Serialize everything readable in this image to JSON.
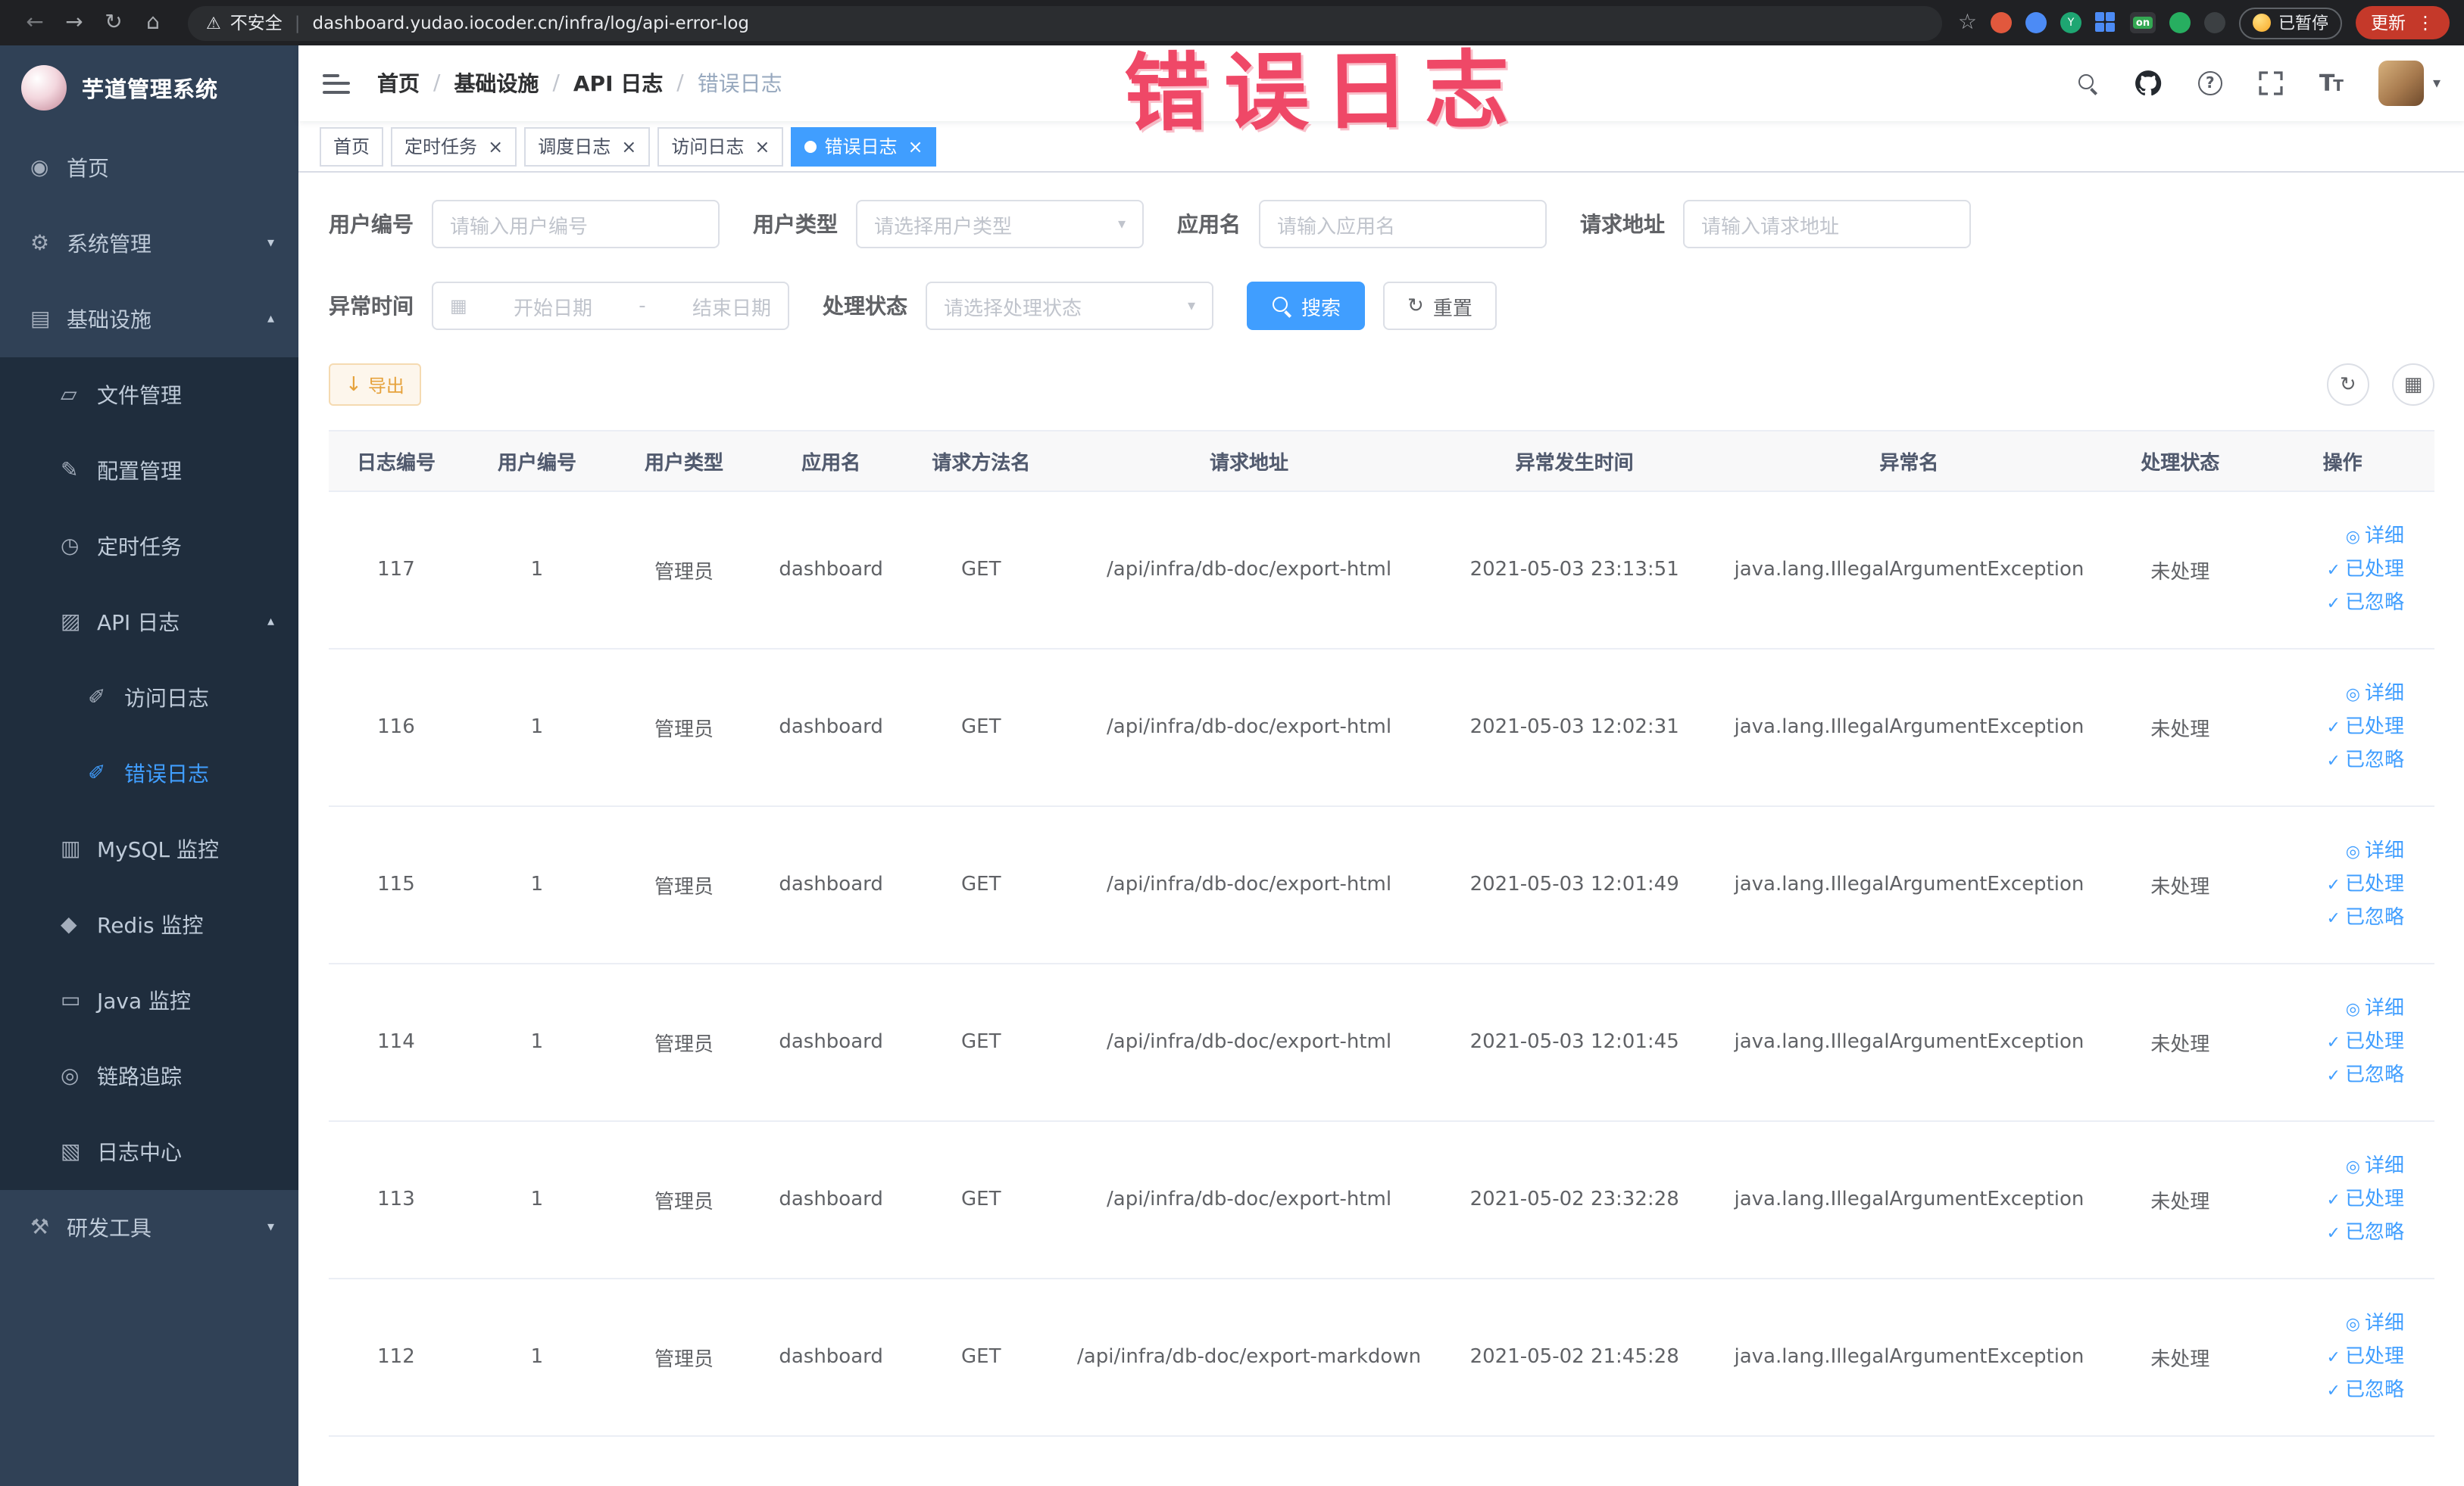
{
  "colors": {
    "accent": "#409eff",
    "sidebar_bg": "#304156",
    "submenu_bg": "#1f2d3d",
    "warning": "#e6a23c",
    "annotation": "#ee3b5c"
  },
  "annotation": {
    "text": "错误日志"
  },
  "browser": {
    "security_label": "不安全",
    "url": "dashboard.yudao.iocoder.cn/infra/log/api-error-log",
    "on_badge": "on",
    "paused_label": "已暂停",
    "update_label": "更新"
  },
  "sidebar": {
    "logo_title": "芋道管理系统",
    "items": [
      {
        "id": "home",
        "label": "首页",
        "icon": "dashboard-icon",
        "level": 0
      },
      {
        "id": "system",
        "label": "系统管理",
        "icon": "gear-icon",
        "level": 0,
        "arrow": "down"
      },
      {
        "id": "infra",
        "label": "基础设施",
        "icon": "infrastructure-icon",
        "level": 0,
        "arrow": "up"
      },
      {
        "id": "file",
        "label": "文件管理",
        "icon": "folder-icon",
        "level": 1,
        "sub": true
      },
      {
        "id": "config",
        "label": "配置管理",
        "icon": "config-icon",
        "level": 1,
        "sub": true
      },
      {
        "id": "job",
        "label": "定时任务",
        "icon": "timer-icon",
        "level": 1,
        "sub": true
      },
      {
        "id": "api-log",
        "label": "API 日志",
        "icon": "api-log-icon",
        "level": 1,
        "sub": true,
        "arrow": "up"
      },
      {
        "id": "access-log",
        "label": "访问日志",
        "icon": "access-log-icon",
        "level": 2,
        "sub": true
      },
      {
        "id": "error-log",
        "label": "错误日志",
        "icon": "error-log-icon",
        "level": 2,
        "sub": true,
        "active": true
      },
      {
        "id": "mysql",
        "label": "MySQL 监控",
        "icon": "mysql-icon",
        "level": 1,
        "sub": true
      },
      {
        "id": "redis",
        "label": "Redis 监控",
        "icon": "redis-icon",
        "level": 1,
        "sub": true
      },
      {
        "id": "java",
        "label": "Java 监控",
        "icon": "java-icon",
        "level": 1,
        "sub": true
      },
      {
        "id": "trace",
        "label": "链路追踪",
        "icon": "trace-icon",
        "level": 1,
        "sub": true
      },
      {
        "id": "log-center",
        "label": "日志中心",
        "icon": "log-center-icon",
        "level": 1,
        "sub": true
      },
      {
        "id": "dev-tools",
        "label": "研发工具",
        "icon": "dev-tools-icon",
        "level": 0,
        "arrow": "down"
      }
    ]
  },
  "breadcrumb": [
    "首页",
    "基础设施",
    "API 日志",
    "错误日志"
  ],
  "tabs": [
    {
      "label": "首页",
      "closable": false,
      "active": false
    },
    {
      "label": "定时任务",
      "closable": true,
      "active": false
    },
    {
      "label": "调度日志",
      "closable": true,
      "active": false
    },
    {
      "label": "访问日志",
      "closable": true,
      "active": false
    },
    {
      "label": "错误日志",
      "closable": true,
      "active": true
    }
  ],
  "filters": {
    "row1": [
      {
        "id": "user-id",
        "label": "用户编号",
        "type": "input",
        "placeholder": "请输入用户编号"
      },
      {
        "id": "user-type",
        "label": "用户类型",
        "type": "select",
        "placeholder": "请选择用户类型"
      },
      {
        "id": "app-name",
        "label": "应用名",
        "type": "input",
        "placeholder": "请输入应用名"
      },
      {
        "id": "request-url",
        "label": "请求地址",
        "type": "input",
        "placeholder": "请输入请求地址"
      }
    ],
    "row2": [
      {
        "id": "exception-time",
        "label": "异常时间",
        "type": "daterange",
        "start_placeholder": "开始日期",
        "separator": "-",
        "end_placeholder": "结束日期"
      },
      {
        "id": "process-status",
        "label": "处理状态",
        "type": "select",
        "placeholder": "请选择处理状态"
      }
    ],
    "search_label": "搜索",
    "reset_label": "重置"
  },
  "toolbar": {
    "export_label": "导出"
  },
  "table": {
    "columns": [
      "日志编号",
      "用户编号",
      "用户类型",
      "应用名",
      "请求方法名",
      "请求地址",
      "异常发生时间",
      "异常名",
      "处理状态",
      "操作"
    ],
    "actions": [
      {
        "label": "详细",
        "icon": "eye-icon"
      },
      {
        "label": "已处理",
        "icon": "check-icon"
      },
      {
        "label": "已忽略",
        "icon": "check-icon"
      }
    ],
    "rows": [
      {
        "cells": [
          "117",
          "1",
          "管理员",
          "dashboard",
          "GET",
          "/api/infra/db-doc/export-html",
          "2021-05-03 23:13:51",
          "java.lang.IllegalArgumentException",
          "未处理"
        ]
      },
      {
        "cells": [
          "116",
          "1",
          "管理员",
          "dashboard",
          "GET",
          "/api/infra/db-doc/export-html",
          "2021-05-03 12:02:31",
          "java.lang.IllegalArgumentException",
          "未处理"
        ]
      },
      {
        "cells": [
          "115",
          "1",
          "管理员",
          "dashboard",
          "GET",
          "/api/infra/db-doc/export-html",
          "2021-05-03 12:01:49",
          "java.lang.IllegalArgumentException",
          "未处理"
        ]
      },
      {
        "cells": [
          "114",
          "1",
          "管理员",
          "dashboard",
          "GET",
          "/api/infra/db-doc/export-html",
          "2021-05-03 12:01:45",
          "java.lang.IllegalArgumentException",
          "未处理"
        ]
      },
      {
        "cells": [
          "113",
          "1",
          "管理员",
          "dashboard",
          "GET",
          "/api/infra/db-doc/export-html",
          "2021-05-02 23:32:28",
          "java.lang.IllegalArgumentException",
          "未处理"
        ]
      },
      {
        "cells": [
          "112",
          "1",
          "管理员",
          "dashboard",
          "GET",
          "/api/infra/db-doc/export-markdown",
          "2021-05-02 21:45:28",
          "java.lang.IllegalArgumentException",
          "未处理"
        ]
      }
    ]
  }
}
